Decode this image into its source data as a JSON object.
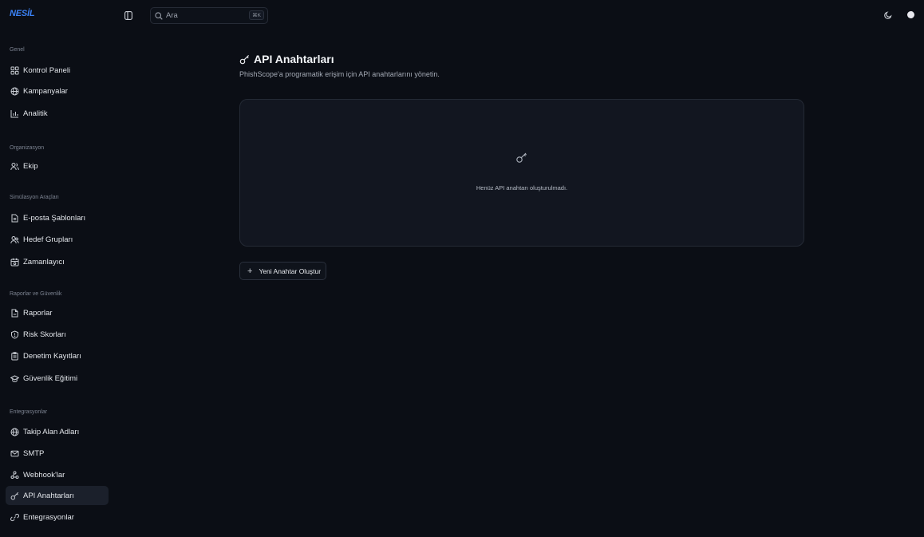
{
  "brand": {
    "logo_text": "NESİL"
  },
  "search": {
    "placeholder": "Ara",
    "shortcut": "⌘K"
  },
  "sidebar": {
    "sections": [
      {
        "title": "Genel",
        "items": [
          {
            "label": "Kontrol Paneli",
            "icon": "dashboard-icon"
          },
          {
            "label": "Kampanyalar",
            "icon": "globe-icon"
          },
          {
            "label": "Analitik",
            "icon": "chart-icon"
          }
        ]
      },
      {
        "title": "Organizasyon",
        "items": [
          {
            "label": "Ekip",
            "icon": "users-icon"
          }
        ]
      },
      {
        "title": "Simülasyon Araçları",
        "items": [
          {
            "label": "E-posta Şablonları",
            "icon": "file-icon"
          },
          {
            "label": "Hedef Grupları",
            "icon": "group-icon"
          },
          {
            "label": "Zamanlayıcı",
            "icon": "calendar-icon"
          }
        ]
      },
      {
        "title": "Raporlar ve Güvenlik",
        "items": [
          {
            "label": "Raporlar",
            "icon": "report-icon"
          },
          {
            "label": "Risk Skorları",
            "icon": "shield-icon"
          },
          {
            "label": "Denetim Kayıtları",
            "icon": "audit-icon"
          },
          {
            "label": "Güvenlik Eğitimi",
            "icon": "graduation-icon"
          }
        ]
      },
      {
        "title": "Entegrasyonlar",
        "items": [
          {
            "label": "Takip Alan Adları",
            "icon": "globe-icon"
          },
          {
            "label": "SMTP",
            "icon": "mail-icon"
          },
          {
            "label": "Webhook'lar",
            "icon": "webhook-icon"
          },
          {
            "label": "API Anahtarları",
            "icon": "key-icon",
            "active": true
          },
          {
            "label": "Entegrasyonlar",
            "icon": "link-icon"
          }
        ]
      }
    ]
  },
  "page": {
    "title": "API Anahtarları",
    "subtitle": "PhishScope'a programatik erişim için API anahtarlarını yönetin.",
    "empty_state": "Henüz API anahtarı oluşturulmadı.",
    "create_button": "Yeni Anahtar Oluştur"
  },
  "colors": {
    "background": "#0b0e15",
    "card": "#121620",
    "accent": "#3b82f6"
  }
}
